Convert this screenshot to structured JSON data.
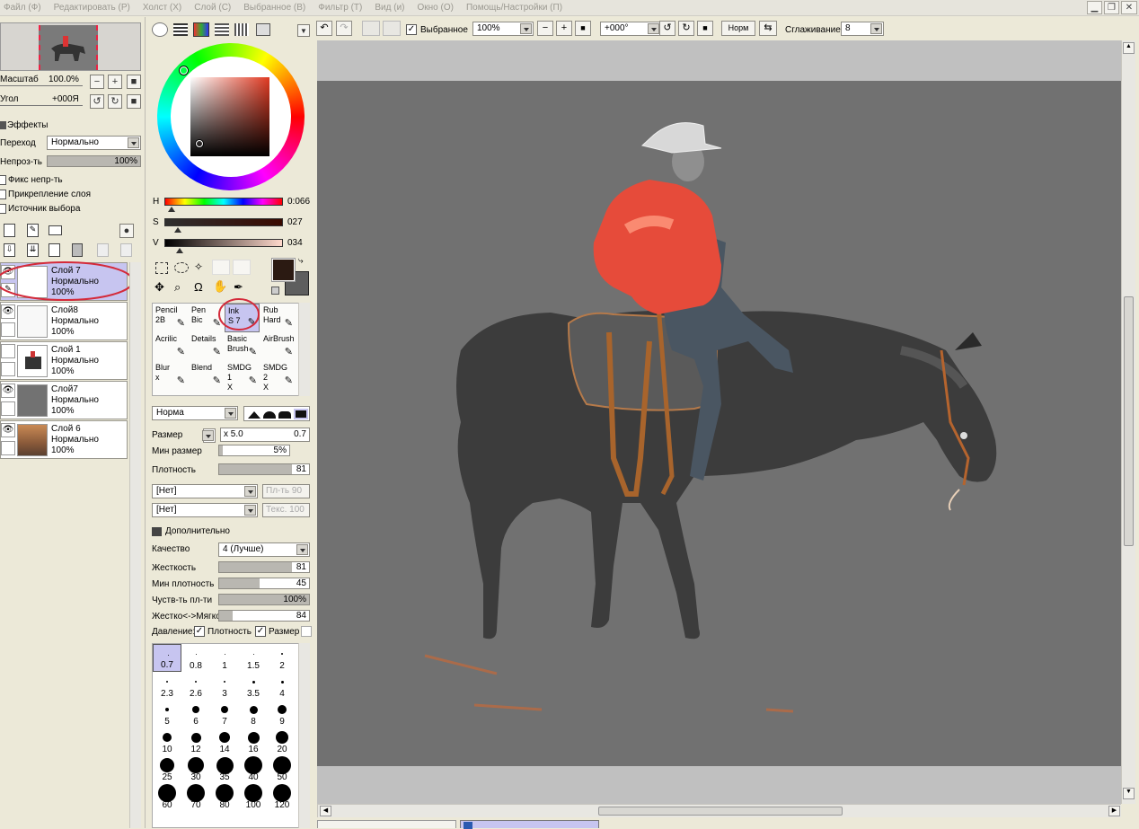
{
  "menu": [
    "Файл (Ф)",
    "Редактировать (Р)",
    "Холст (Х)",
    "Слой (С)",
    "Выбранное (В)",
    "Фильтр (Т)",
    "Вид (и)",
    "Окно (О)",
    "Помощь/Настройки (П)"
  ],
  "nav": {
    "zoom_label": "Масштаб",
    "zoom_value": "100.0%",
    "angle_label": "Угол",
    "angle_value": "+000Я"
  },
  "effects": {
    "title": "Эффекты",
    "blend_label": "Переход",
    "blend_value": "Нормально",
    "opacity_label": "Непроз-ть",
    "opacity_value": "100%",
    "opacity_pct": 100
  },
  "checks": [
    "Фикс непр-ть",
    "Прикрепление слоя",
    "Источник выбора"
  ],
  "layers": [
    {
      "name": "Слой 7",
      "mode": "Нормально",
      "opacity": "100%",
      "selected": true
    },
    {
      "name": "Слой8",
      "mode": "Нормально",
      "opacity": "100%",
      "selected": false
    },
    {
      "name": "Слой 1",
      "mode": "Нормально",
      "opacity": "100%",
      "selected": false
    },
    {
      "name": "Слой7",
      "mode": "Нормально",
      "opacity": "100%",
      "selected": false
    },
    {
      "name": "Слой 6",
      "mode": "Нормально",
      "opacity": "100%",
      "selected": false
    }
  ],
  "hsv": {
    "h_label": "H",
    "h_value": "0:066",
    "s_label": "S",
    "s_value": "027",
    "v_label": "V",
    "v_value": "034",
    "h_frac": 0.06,
    "s_frac": 0.11,
    "v_frac": 0.13
  },
  "colors": {
    "primary": "#2b1a12",
    "secondary": "#5e5e5e",
    "accent": "#c7c5f0",
    "canvas": "#717171",
    "canvas_area": "#c0c0c0",
    "highlight_circle": "#d42a3a"
  },
  "brushes": [
    {
      "l1": "Pencil",
      "l2": "2B"
    },
    {
      "l1": "Pen",
      "l2": "Bic"
    },
    {
      "l1": "Ink",
      "l2": "S 7",
      "selected": true
    },
    {
      "l1": "Rub",
      "l2": "Hard"
    },
    {
      "l1": "Acrilic",
      "l2": ""
    },
    {
      "l1": "Details",
      "l2": ""
    },
    {
      "l1": "Basic",
      "l2": "Brush"
    },
    {
      "l1": "AirBrush",
      "l2": ""
    },
    {
      "l1": "Blur",
      "l2": "x"
    },
    {
      "l1": "Blend",
      "l2": ""
    },
    {
      "l1": "SMDG 1",
      "l2": "X"
    },
    {
      "l1": "SMDG 2",
      "l2": "X"
    }
  ],
  "brush_settings": {
    "mode": "Норма",
    "size_label": "Размер",
    "size_mult": "x 5.0",
    "size_value": "0.7",
    "min_size_label": "Мин размер",
    "min_size_value": "5%",
    "min_size_pct": 5,
    "density_label": "Плотность",
    "density_value": "81",
    "density_pct": 81,
    "texture1": "[Нет]",
    "texture1_side": "Пл-ть 90",
    "texture2": "[Нет]",
    "texture2_side": "Текс. 100",
    "advanced_title": "Дополнительно",
    "quality_label": "Качество",
    "quality_value": "4 (Лучше)",
    "hardness_label": "Жесткость",
    "hardness_value": "81",
    "hardness_pct": 81,
    "min_density_label": "Мин плотность",
    "min_density_value": "45",
    "min_density_pct": 45,
    "sens_label": "Чуств-ть пл-ти",
    "sens_value": "100%",
    "sens_pct": 100,
    "hardsoft_label": "Жестко<->Мягко",
    "hardsoft_value": "84",
    "hardsoft_pct": 15,
    "pressure_label": "Давление:",
    "pressure_density": "Плотность",
    "pressure_size": "Размер"
  },
  "sizes": [
    "0.7",
    "0.8",
    "1",
    "1.5",
    "2",
    "2.3",
    "2.6",
    "3",
    "3.5",
    "4",
    "5",
    "6",
    "7",
    "8",
    "9",
    "10",
    "12",
    "14",
    "16",
    "20",
    "25",
    "30",
    "35",
    "40",
    "50",
    "60",
    "70",
    "80",
    "100",
    "120"
  ],
  "toolbar": {
    "selection_label": "Выбранное",
    "zoom": "100%",
    "angle": "+000°",
    "norm_label": "Норм",
    "smoothing_label": "Сглаживание",
    "smoothing_value": "8"
  }
}
